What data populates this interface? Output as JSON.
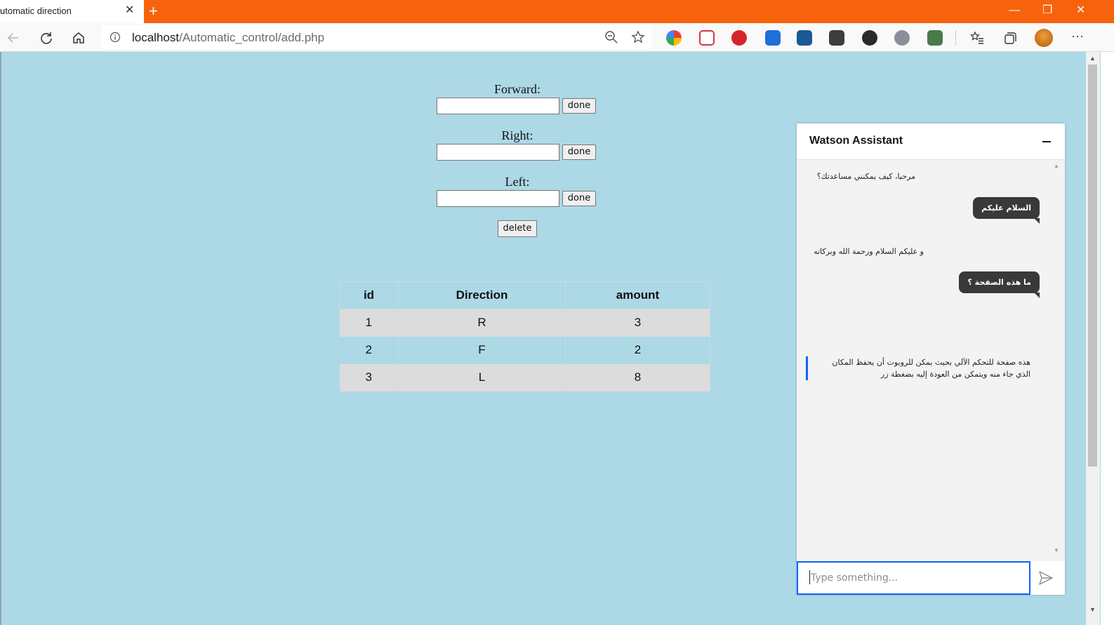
{
  "browser": {
    "tab_title": "utomatic direction",
    "tab_close": "✕",
    "new_tab": "+",
    "window_controls": {
      "minimize": "—",
      "restore": "❐",
      "close": "✕"
    },
    "address": {
      "host": "localhost",
      "path": "/Automatic_control/add.php"
    },
    "menu_label": "···",
    "extension_icons": [
      "color-ext-icon",
      "pocket-icon",
      "adblock-icon",
      "screen-ext-icon",
      "photo-ext-icon",
      "shield-ext-icon",
      "download-ext-icon",
      "speed-ext-icon",
      "translate-ext-icon"
    ],
    "toolbar_icons": [
      "back-icon",
      "refresh-icon",
      "home-icon",
      "info-icon",
      "zoom-icon",
      "favorite-star-icon",
      "favorites-icon",
      "collections-icon",
      "profile-avatar",
      "more-icon"
    ],
    "colors": {
      "titlebar": "#f7630c",
      "page_bg": "#add8e6"
    }
  },
  "form": {
    "forward": {
      "label": "Forward:",
      "value": "",
      "button": "done"
    },
    "right": {
      "label": "Right:",
      "value": "",
      "button": "done"
    },
    "left": {
      "label": "Left:",
      "value": "",
      "button": "done"
    },
    "delete_button": "delete"
  },
  "table": {
    "headers": [
      "id",
      "Direction",
      "amount"
    ],
    "rows": [
      [
        "1",
        "R",
        "3"
      ],
      [
        "2",
        "F",
        "2"
      ],
      [
        "3",
        "L",
        "8"
      ]
    ]
  },
  "chat": {
    "title": "Watson Assistant",
    "messages": [
      {
        "from": "assistant",
        "text": "مرحبا، كيف يمكنني مساعدتك؟"
      },
      {
        "from": "user",
        "text": "السلام عليكم"
      },
      {
        "from": "assistant",
        "text": "و عليكم السلام ورحمة الله وبركاته"
      },
      {
        "from": "user",
        "text": "ما هذه الصفحة ؟"
      },
      {
        "from": "assistant",
        "text": "هذه صفحة للتحكم الآلي بحيث يمكن للروبوت أن يحفظ المكان الذي جاء منه ويتمكن من العودة إليه بضغطة زر"
      }
    ],
    "input_placeholder": "Type something...",
    "colors": {
      "accent": "#0f62fe",
      "user_bubble": "#393939"
    }
  }
}
